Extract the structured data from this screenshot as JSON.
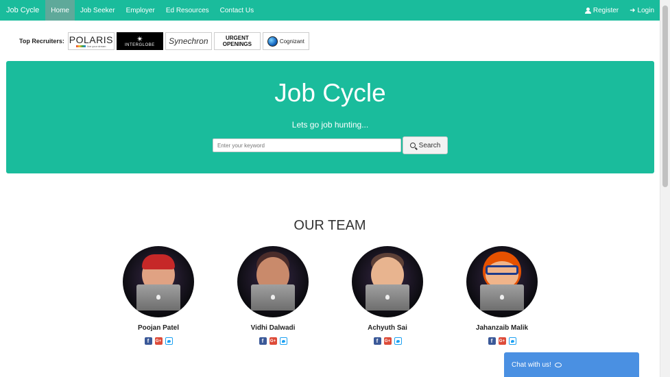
{
  "navbar": {
    "brand": "Job Cycle",
    "items": [
      {
        "label": "Home",
        "active": true
      },
      {
        "label": "Job Seeker"
      },
      {
        "label": "Employer"
      },
      {
        "label": "Ed Resources"
      },
      {
        "label": "Contact Us"
      }
    ],
    "register_label": "Register",
    "login_label": "Login",
    "color": "#1abc9c"
  },
  "recruiters": {
    "label": "Top Recruiters:",
    "logos": [
      {
        "name": "POLARIS",
        "tagline": "live your dream"
      },
      {
        "name": "✴",
        "tagline": "INTERGLOBE"
      },
      {
        "name": "Synechron"
      },
      {
        "name": "URGENT OPENINGS"
      },
      {
        "name": "Cognizant"
      }
    ]
  },
  "hero": {
    "title": "Job Cycle",
    "subtitle": "Lets go job hunting...",
    "search_placeholder": "Enter your keyword",
    "search_button": "Search"
  },
  "team": {
    "heading": "OUR TEAM",
    "members": [
      {
        "name": "Poojan Patel"
      },
      {
        "name": "Vidhi Dalwadi"
      },
      {
        "name": "Achyuth Sai"
      },
      {
        "name": "Jahanzaib Malik"
      }
    ]
  },
  "chat": {
    "label": "Chat with us!"
  }
}
